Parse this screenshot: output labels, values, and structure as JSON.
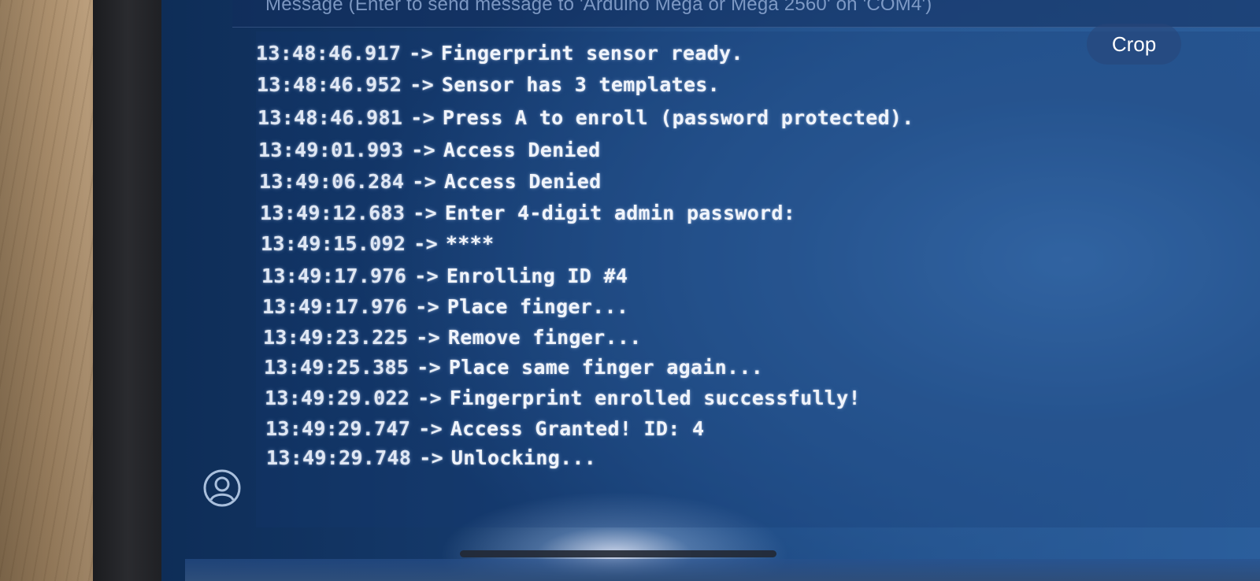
{
  "input_bar": {
    "placeholder": "Message (Enter to send message to 'Arduino Mega or Mega 2560' on 'COM4')"
  },
  "serial_output": {
    "lines": [
      {
        "timestamp": "13:48:46.917",
        "arrow": "->",
        "message": "Fingerprint sensor ready."
      },
      {
        "timestamp": "13:48:46.952",
        "arrow": "->",
        "message": "Sensor has 3 templates."
      },
      {
        "timestamp": "13:48:46.981",
        "arrow": "->",
        "message": "Press A to enroll (password protected)."
      },
      {
        "timestamp": "13:49:01.993",
        "arrow": "->",
        "message": "Access Denied"
      },
      {
        "timestamp": "13:49:06.284",
        "arrow": "->",
        "message": "Access Denied"
      },
      {
        "timestamp": "13:49:12.683",
        "arrow": "->",
        "message": "Enter 4-digit admin password:"
      },
      {
        "timestamp": "13:49:15.092",
        "arrow": "->",
        "message": "****"
      },
      {
        "timestamp": "13:49:17.976",
        "arrow": "->",
        "message": "Enrolling ID #4"
      },
      {
        "timestamp": "13:49:17.976",
        "arrow": "->",
        "message": "Place finger..."
      },
      {
        "timestamp": "13:49:23.225",
        "arrow": "->",
        "message": "Remove finger..."
      },
      {
        "timestamp": "13:49:25.385",
        "arrow": "->",
        "message": "Place same finger again..."
      },
      {
        "timestamp": "13:49:29.022",
        "arrow": "->",
        "message": "Fingerprint enrolled successfully!"
      },
      {
        "timestamp": "13:49:29.747",
        "arrow": "->",
        "message": "Access Granted! ID: 4"
      },
      {
        "timestamp": "13:49:29.748",
        "arrow": "->",
        "message": "Unlocking..."
      }
    ]
  },
  "overlay": {
    "crop_label": "Crop"
  },
  "icons": {
    "avatar": "account-circle-icon"
  },
  "colors": {
    "terminal_text": "#e6edf7",
    "screen_blue": "#1d4a84",
    "crop_button_bg": "#28467a"
  }
}
